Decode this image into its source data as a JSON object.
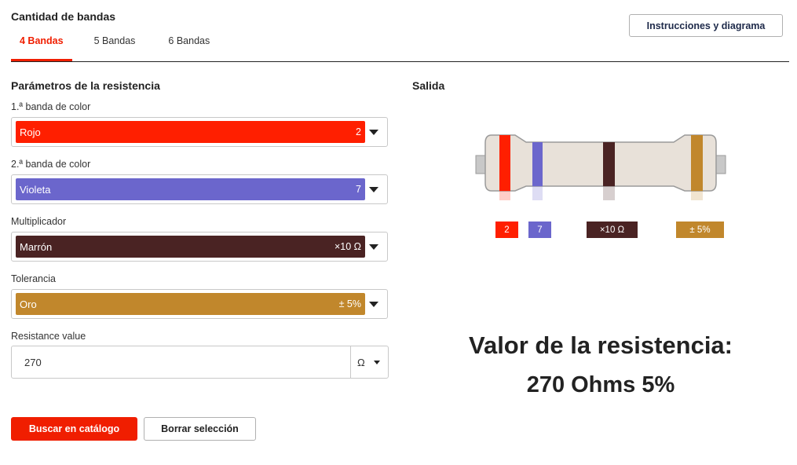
{
  "band_count": {
    "title": "Cantidad de bandas",
    "tabs": [
      {
        "label": "4 Bandas",
        "active": true
      },
      {
        "label": "5 Bandas",
        "active": false
      },
      {
        "label": "6 Bandas",
        "active": false
      }
    ],
    "instructions_button": "Instrucciones y diagrama"
  },
  "params": {
    "title": "Parámetros de la resistencia",
    "fields": [
      {
        "label": "1.ª banda de color",
        "color_name": "Rojo",
        "value": "2",
        "color": "#ff1f00"
      },
      {
        "label": "2.ª banda de color",
        "color_name": "Violeta",
        "value": "7",
        "color": "#6b66cc"
      },
      {
        "label": "Multiplicador",
        "color_name": "Marrón",
        "value": "×10 Ω",
        "color": "#4a2323"
      },
      {
        "label": "Tolerancia",
        "color_name": "Oro",
        "value": "± 5%",
        "color": "#c1872c"
      }
    ],
    "resistance": {
      "label": "Resistance value",
      "value": "270",
      "unit": "Ω"
    }
  },
  "actions": {
    "search": "Buscar en catálogo",
    "clear": "Borrar selección"
  },
  "output": {
    "title": "Salida",
    "body_color": "#e8e1d9",
    "bands": [
      {
        "label": "2",
        "color": "#ff1f00"
      },
      {
        "label": "7",
        "color": "#6b66cc"
      },
      {
        "label": "×10 Ω",
        "color": "#4a2323"
      },
      {
        "label": "± 5%",
        "color": "#c1872c"
      }
    ],
    "result_title": "Valor de la resistencia:",
    "result_value": "270 Ohms 5%"
  }
}
